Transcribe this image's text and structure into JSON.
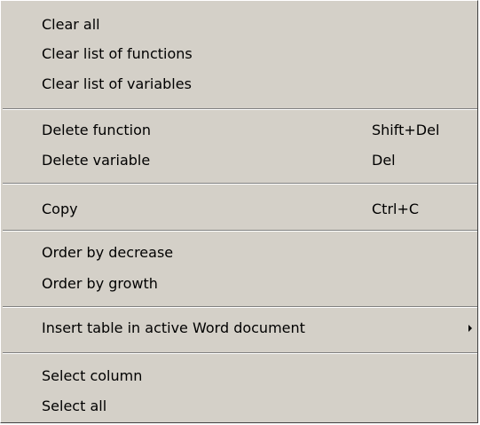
{
  "menu": {
    "items": [
      {
        "label": "Clear all"
      },
      {
        "label": "Clear list of functions"
      },
      {
        "label": "Clear list of variables"
      },
      {
        "label": "Delete function",
        "shortcut": "Shift+Del"
      },
      {
        "label": "Delete variable",
        "shortcut": "Del"
      },
      {
        "label": "Copy",
        "shortcut": "Ctrl+C"
      },
      {
        "label": "Order by decrease"
      },
      {
        "label": "Order by growth"
      },
      {
        "label": "Insert table in active Word document",
        "submenu_icon": "chevron-right-icon"
      },
      {
        "label": "Select column"
      },
      {
        "label": "Select all"
      }
    ]
  }
}
